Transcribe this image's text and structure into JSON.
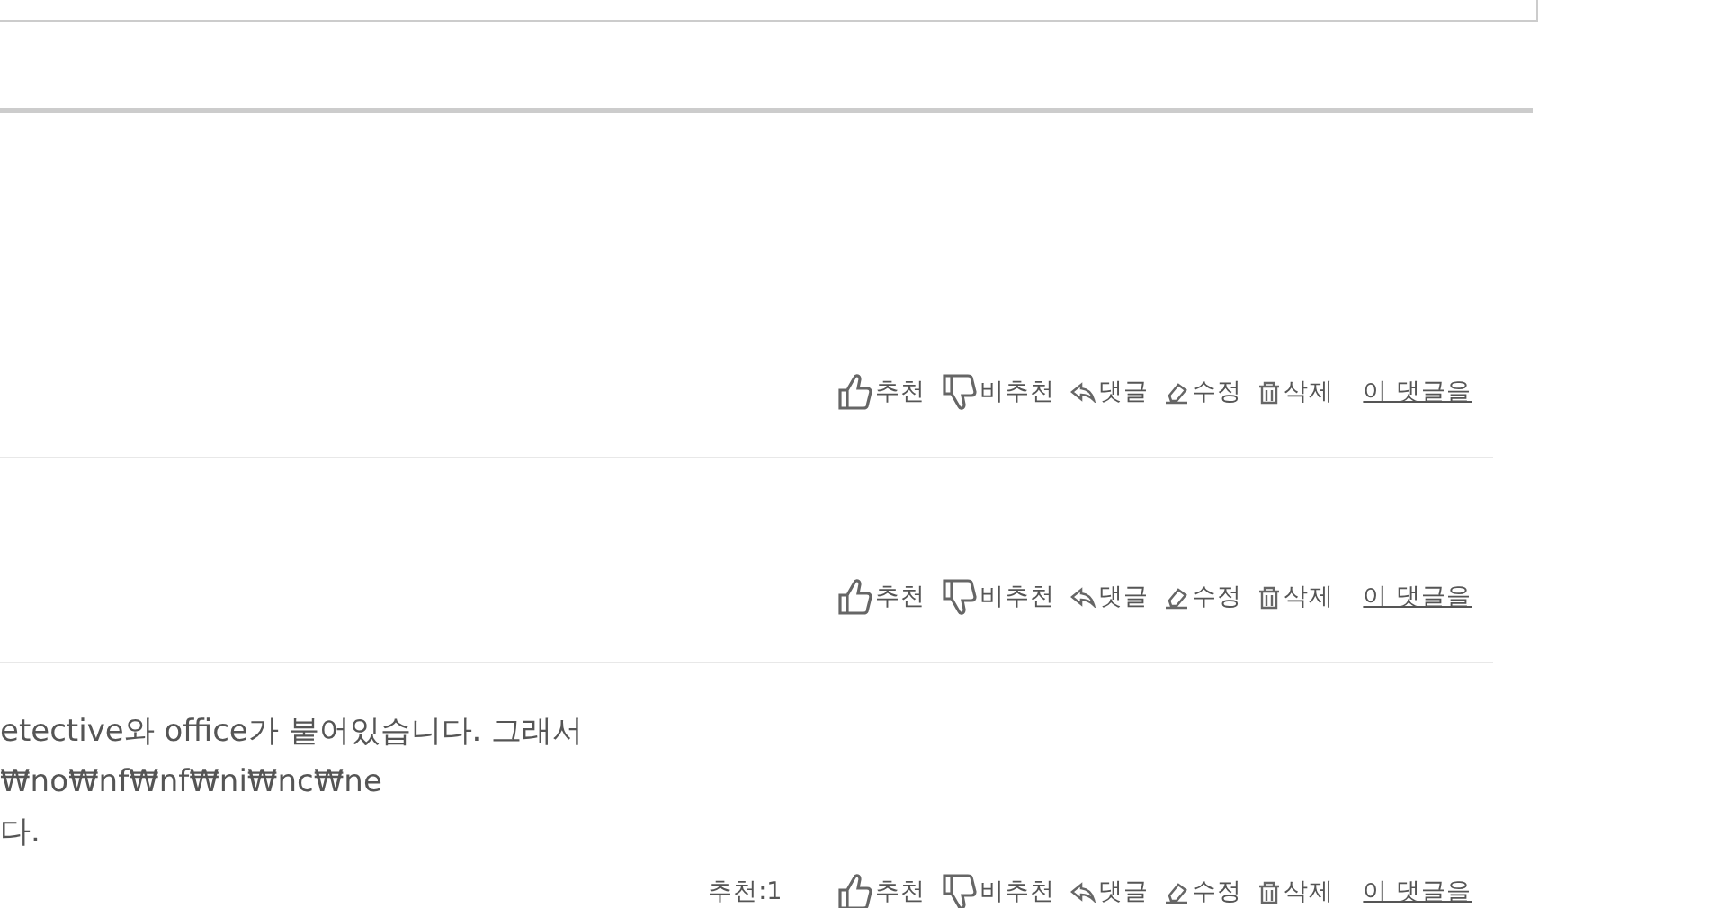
{
  "comments": [
    {
      "actions": [
        {
          "kind": "like",
          "label": "추천"
        },
        {
          "kind": "dislike",
          "label": "비추천"
        },
        {
          "kind": "reply",
          "label": "댓글"
        },
        {
          "kind": "edit",
          "label": "수정"
        },
        {
          "kind": "delete",
          "label": "삭제"
        },
        {
          "kind": "link",
          "label": "이 댓글을"
        }
      ]
    },
    {
      "actions": [
        {
          "kind": "like",
          "label": "추천"
        },
        {
          "kind": "dislike",
          "label": "비추천"
        },
        {
          "kind": "reply",
          "label": "댓글"
        },
        {
          "kind": "edit",
          "label": "수정"
        },
        {
          "kind": "delete",
          "label": "삭제"
        },
        {
          "kind": "link",
          "label": "이 댓글을"
        }
      ]
    },
    {
      "body_lines": [
        "etective와 office가 붙어있습니다. 그래서",
        "₩no₩nf₩nf₩ni₩nc₩ne",
        "다."
      ],
      "recommend_count": "추천:1",
      "actions": [
        {
          "kind": "like",
          "label": "추천"
        },
        {
          "kind": "dislike",
          "label": "비추천"
        },
        {
          "kind": "reply",
          "label": "댓글"
        },
        {
          "kind": "edit",
          "label": "수정"
        },
        {
          "kind": "delete",
          "label": "삭제"
        },
        {
          "kind": "link",
          "label": "이 댓글을"
        }
      ]
    }
  ]
}
